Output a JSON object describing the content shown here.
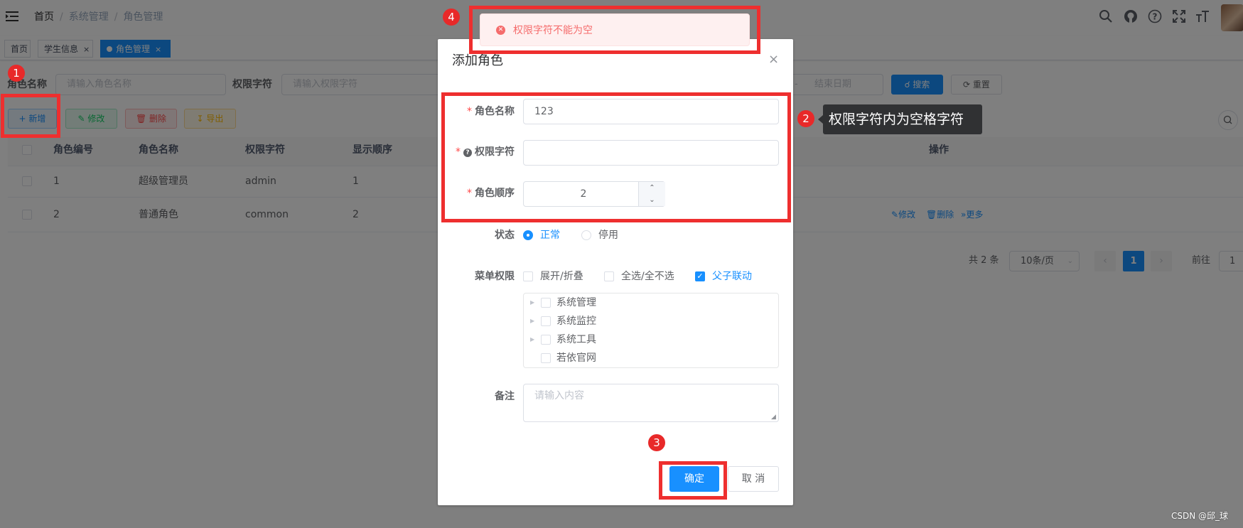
{
  "header": {
    "breadcrumb": [
      "首页",
      "系统管理",
      "角色管理"
    ]
  },
  "tags": [
    {
      "label": "首页"
    },
    {
      "label": "学生信息",
      "close": "×"
    },
    {
      "label": "角色管理",
      "close": "×"
    }
  ],
  "search": {
    "role_name_label": "角色名称",
    "role_name_placeholder": "请输入角色名称",
    "perm_label": "权限字符",
    "perm_placeholder": "请输入权限字符",
    "range_sep": "-",
    "end_date_placeholder": "结束日期",
    "search_button": "搜索",
    "reset_button": "重置"
  },
  "toolbar": {
    "add": "新增",
    "edit": "修改",
    "delete": "删除",
    "export": "导出"
  },
  "table": {
    "columns": [
      "角色编号",
      "角色名称",
      "权限字符",
      "显示顺序",
      "操作"
    ],
    "rows": [
      {
        "id": "1",
        "name": "超级管理员",
        "key": "admin",
        "sort": "1"
      },
      {
        "id": "2",
        "name": "普通角色",
        "key": "common",
        "sort": "2",
        "actions": [
          "修改",
          "删除",
          "更多"
        ]
      }
    ]
  },
  "pagination": {
    "total": "共 2 条",
    "page_size": "10条/页",
    "current_page": "1",
    "goto_label": "前往",
    "goto_value": "1"
  },
  "dialog": {
    "title": "添加角色",
    "close": "×",
    "role_name_label": "角色名称",
    "role_name_value": "123",
    "role_key_label": "权限字符",
    "role_key_value": "",
    "role_sort_label": "角色顺序",
    "role_sort_value": "2",
    "status_label": "状态",
    "status_options": [
      "正常",
      "停用"
    ],
    "status_selected": "正常",
    "menu_label": "菜单权限",
    "menu_options": [
      {
        "label": "展开/折叠",
        "checked": false
      },
      {
        "label": "全选/全不选",
        "checked": false
      },
      {
        "label": "父子联动",
        "checked": true
      }
    ],
    "tree": [
      "系统管理",
      "系统监控",
      "系统工具",
      "若依官网"
    ],
    "remark_label": "备注",
    "remark_placeholder": "请输入内容",
    "confirm": "确定",
    "cancel": "取 消"
  },
  "message": {
    "text": "权限字符不能为空",
    "type": "error"
  },
  "annotations": {
    "badges": [
      "1",
      "2",
      "3",
      "4"
    ],
    "tooltip": "权限字符内为空格字符",
    "color": "#ee2f2f"
  },
  "watermark": "CSDN @邱_球",
  "colors": {
    "primary": "#1890ff",
    "danger": "#ff4949",
    "annotation": "#ee2f2f"
  },
  "icons": [
    "hamburger-icon",
    "search-icon",
    "github-icon",
    "question-icon",
    "fullscreen-icon",
    "font-size-icon",
    "plus-icon",
    "edit-icon",
    "delete-icon",
    "download-icon",
    "refresh-icon",
    "close-icon",
    "error-icon",
    "caret-right-icon"
  ]
}
